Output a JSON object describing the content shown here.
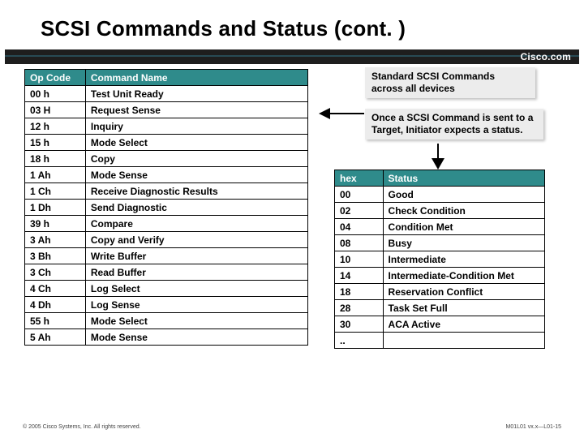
{
  "title": "SCSI Commands and Status (cont. )",
  "brand": "Cisco.com",
  "callouts": {
    "top": "Standard SCSI Commands across all devices",
    "mid": "Once a SCSI Command is sent to a Target, Initiator expects a status."
  },
  "commands_table": {
    "headers": [
      "Op Code",
      "Command Name"
    ],
    "rows": [
      [
        "00 h",
        "Test Unit Ready"
      ],
      [
        "03 H",
        "Request Sense"
      ],
      [
        "12 h",
        "Inquiry"
      ],
      [
        "15 h",
        "Mode Select"
      ],
      [
        "18 h",
        "Copy"
      ],
      [
        "1 Ah",
        "Mode Sense"
      ],
      [
        "1 Ch",
        "Receive Diagnostic Results"
      ],
      [
        "1 Dh",
        "Send Diagnostic"
      ],
      [
        "39 h",
        "Compare"
      ],
      [
        "3 Ah",
        "Copy and Verify"
      ],
      [
        "3 Bh",
        "Write Buffer"
      ],
      [
        "3 Ch",
        "Read Buffer"
      ],
      [
        "4 Ch",
        "Log Select"
      ],
      [
        "4 Dh",
        "Log Sense"
      ],
      [
        "55 h",
        "Mode Select"
      ],
      [
        "5 Ah",
        "Mode Sense"
      ]
    ]
  },
  "status_table": {
    "headers": [
      "hex",
      "Status"
    ],
    "rows": [
      [
        "00",
        "Good"
      ],
      [
        "02",
        "Check Condition"
      ],
      [
        "04",
        "Condition Met"
      ],
      [
        "08",
        "Busy"
      ],
      [
        "10",
        "Intermediate"
      ],
      [
        "14",
        "Intermediate-Condition Met"
      ],
      [
        "18",
        "Reservation Conflict"
      ],
      [
        "28",
        "Task Set Full"
      ],
      [
        "30",
        "ACA Active"
      ],
      [
        "..",
        ""
      ]
    ]
  },
  "footer": {
    "left": "© 2005 Cisco Systems, Inc. All rights reserved.",
    "right": "M01L01 vx.x—L01-15"
  }
}
